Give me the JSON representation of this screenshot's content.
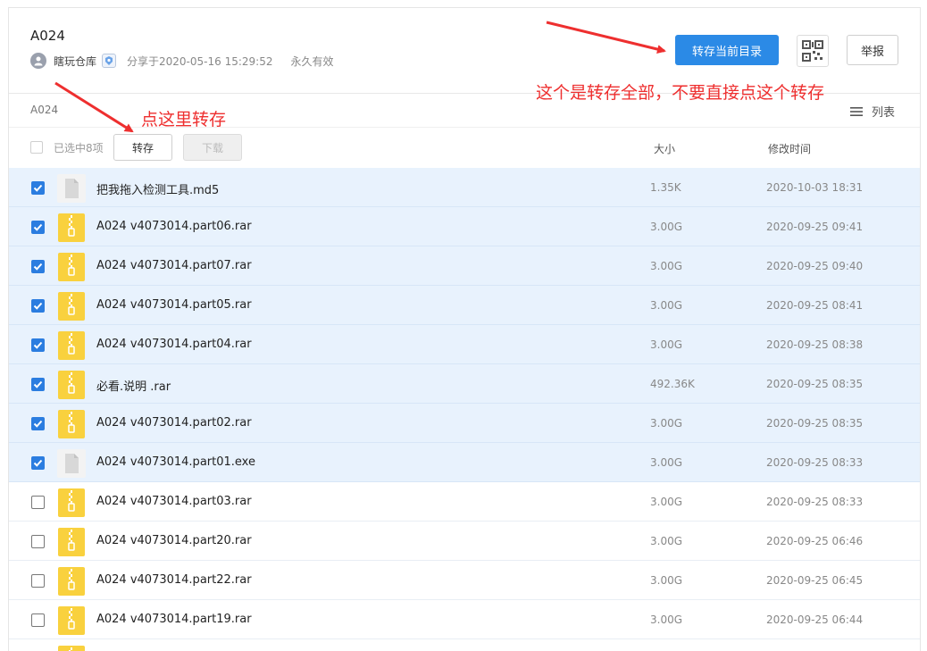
{
  "header": {
    "title": "A024",
    "user": "瞎玩仓库",
    "share_time": "分享于2020-05-16 15:29:52",
    "validity": "永久有效",
    "save_all_label": "转存当前目录",
    "report_label": "举报"
  },
  "breadcrumb": "A024",
  "view_toggle_label": "列表",
  "toolbar": {
    "selected_label": "已选中8项",
    "save_label": "转存",
    "download_label": "下载"
  },
  "columns": {
    "size": "大小",
    "time": "修改时间"
  },
  "files": [
    {
      "name": "把我拖入检测工具.md5",
      "size": "1.35K",
      "time": "2020-10-03 18:31",
      "type": "doc",
      "checked": true
    },
    {
      "name": "A024 v4073014.part06.rar",
      "size": "3.00G",
      "time": "2020-09-25 09:41",
      "type": "zip",
      "checked": true
    },
    {
      "name": "A024 v4073014.part07.rar",
      "size": "3.00G",
      "time": "2020-09-25 09:40",
      "type": "zip",
      "checked": true
    },
    {
      "name": "A024 v4073014.part05.rar",
      "size": "3.00G",
      "time": "2020-09-25 08:41",
      "type": "zip",
      "checked": true
    },
    {
      "name": "A024 v4073014.part04.rar",
      "size": "3.00G",
      "time": "2020-09-25 08:38",
      "type": "zip",
      "checked": true
    },
    {
      "name": "必看.说明 .rar",
      "size": "492.36K",
      "time": "2020-09-25 08:35",
      "type": "zip",
      "checked": true
    },
    {
      "name": "A024 v4073014.part02.rar",
      "size": "3.00G",
      "time": "2020-09-25 08:35",
      "type": "zip",
      "checked": true
    },
    {
      "name": "A024 v4073014.part01.exe",
      "size": "3.00G",
      "time": "2020-09-25 08:33",
      "type": "doc",
      "checked": true
    },
    {
      "name": "A024 v4073014.part03.rar",
      "size": "3.00G",
      "time": "2020-09-25 08:33",
      "type": "zip",
      "checked": false
    },
    {
      "name": "A024 v4073014.part20.rar",
      "size": "3.00G",
      "time": "2020-09-25 06:46",
      "type": "zip",
      "checked": false
    },
    {
      "name": "A024 v4073014.part22.rar",
      "size": "3.00G",
      "time": "2020-09-25 06:45",
      "type": "zip",
      "checked": false
    },
    {
      "name": "A024 v4073014.part19.rar",
      "size": "3.00G",
      "time": "2020-09-25 06:44",
      "type": "zip",
      "checked": false
    },
    {
      "name": "",
      "size": "",
      "time": "",
      "type": "zip",
      "checked": false
    }
  ],
  "annotations": {
    "click_here": "点这里转存",
    "save_all_warning": "这个是转存全部，不要直接点这个转存"
  },
  "colors": {
    "primary": "#2b8ae6",
    "checked_row": "#e8f2fd",
    "annotation": "#ee2f2f",
    "zip_icon": "#f9d13e"
  }
}
